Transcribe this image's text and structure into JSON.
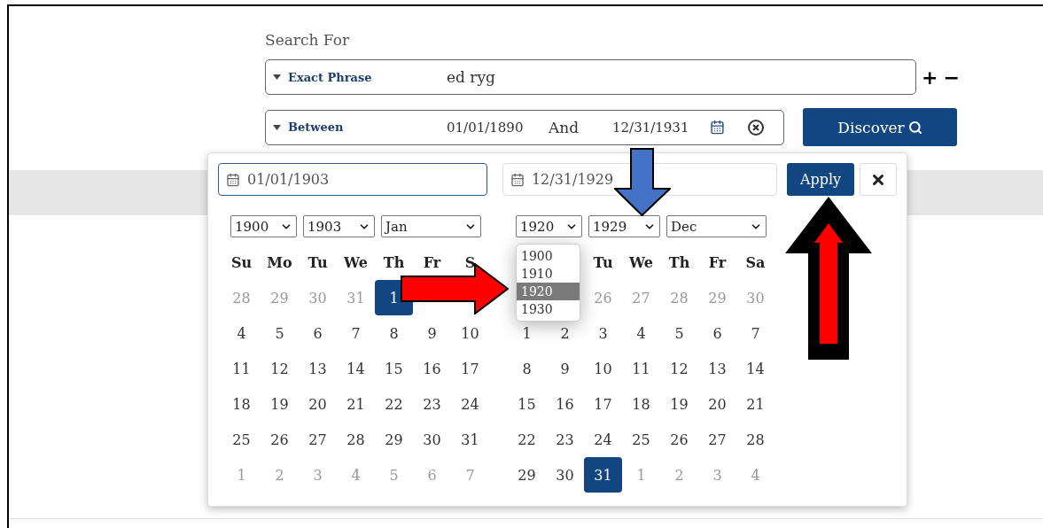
{
  "search_for_label": "Search For",
  "rows": [
    {
      "kind": "text",
      "operator": "Exact Phrase",
      "value": "ed ryg"
    },
    {
      "kind": "range",
      "operator": "Between",
      "from": "01/01/1890",
      "joiner": "And",
      "to": "12/31/1931"
    }
  ],
  "add_sign": "+",
  "remove_sign": "−",
  "discover_button": "Discover",
  "picker": {
    "from_input": "01/01/1903",
    "to_input": "12/31/1929",
    "apply_button": "Apply",
    "calendars": [
      {
        "selects": [
          "1900",
          "1903",
          "Jan"
        ],
        "weekdays": [
          {
            "label": "Su"
          },
          {
            "label": "Mo"
          },
          {
            "label": "Tu"
          },
          {
            "label": "We"
          },
          {
            "label": "Th"
          },
          {
            "label": "Fr"
          },
          {
            "label": "S"
          }
        ],
        "weeks": [
          [
            {
              "day": "28",
              "muted": true,
              "selected": false
            },
            {
              "day": "29",
              "muted": true,
              "selected": false
            },
            {
              "day": "30",
              "muted": true,
              "selected": false
            },
            {
              "day": "31",
              "muted": true,
              "selected": false
            },
            {
              "day": "1",
              "muted": false,
              "selected": true
            }
          ],
          [
            {
              "day": "4",
              "muted": false,
              "selected": false
            },
            {
              "day": "5",
              "muted": false,
              "selected": false
            },
            {
              "day": "6",
              "muted": false,
              "selected": false
            },
            {
              "day": "7",
              "muted": false,
              "selected": false
            },
            {
              "day": "8",
              "muted": false,
              "selected": false
            },
            {
              "day": "9",
              "muted": false,
              "selected": false
            },
            {
              "day": "10",
              "muted": false,
              "selected": false
            }
          ],
          [
            {
              "day": "11",
              "muted": false,
              "selected": false
            },
            {
              "day": "12",
              "muted": false,
              "selected": false
            },
            {
              "day": "13",
              "muted": false,
              "selected": false
            },
            {
              "day": "14",
              "muted": false,
              "selected": false
            },
            {
              "day": "15",
              "muted": false,
              "selected": false
            },
            {
              "day": "16",
              "muted": false,
              "selected": false
            },
            {
              "day": "17",
              "muted": false,
              "selected": false
            }
          ],
          [
            {
              "day": "18",
              "muted": false,
              "selected": false
            },
            {
              "day": "19",
              "muted": false,
              "selected": false
            },
            {
              "day": "20",
              "muted": false,
              "selected": false
            },
            {
              "day": "21",
              "muted": false,
              "selected": false
            },
            {
              "day": "22",
              "muted": false,
              "selected": false
            },
            {
              "day": "23",
              "muted": false,
              "selected": false
            },
            {
              "day": "24",
              "muted": false,
              "selected": false
            }
          ],
          [
            {
              "day": "25",
              "muted": false,
              "selected": false
            },
            {
              "day": "26",
              "muted": false,
              "selected": false
            },
            {
              "day": "27",
              "muted": false,
              "selected": false
            },
            {
              "day": "28",
              "muted": false,
              "selected": false
            },
            {
              "day": "29",
              "muted": false,
              "selected": false
            },
            {
              "day": "30",
              "muted": false,
              "selected": false
            },
            {
              "day": "31",
              "muted": false,
              "selected": false
            }
          ],
          [
            {
              "day": "1",
              "muted": true,
              "selected": false
            },
            {
              "day": "2",
              "muted": true,
              "selected": false
            },
            {
              "day": "3",
              "muted": true,
              "selected": false
            },
            {
              "day": "4",
              "muted": true,
              "selected": false
            },
            {
              "day": "5",
              "muted": true,
              "selected": false
            },
            {
              "day": "6",
              "muted": true,
              "selected": false
            },
            {
              "day": "7",
              "muted": true,
              "selected": false
            }
          ]
        ]
      },
      {
        "selects": [
          "1920",
          "1929",
          "Dec"
        ],
        "year_options": [
          {
            "label": "1900",
            "selected": false
          },
          {
            "label": "1910",
            "selected": false
          },
          {
            "label": "1920",
            "selected": true
          },
          {
            "label": "1930",
            "selected": false
          }
        ],
        "weekdays": [
          {
            "label": "Tu"
          },
          {
            "label": "We"
          },
          {
            "label": "Th"
          },
          {
            "label": "Fr"
          },
          {
            "label": "Sa"
          }
        ],
        "weeks": [
          [
            {
              "day": "26",
              "muted": true,
              "selected": false
            },
            {
              "day": "27",
              "muted": true,
              "selected": false
            },
            {
              "day": "28",
              "muted": true,
              "selected": false
            },
            {
              "day": "29",
              "muted": true,
              "selected": false
            },
            {
              "day": "30",
              "muted": true,
              "selected": false
            }
          ],
          [
            {
              "day": "1",
              "muted": false,
              "selected": false
            },
            {
              "day": "2",
              "muted": false,
              "selected": false
            },
            {
              "day": "3",
              "muted": false,
              "selected": false
            },
            {
              "day": "4",
              "muted": false,
              "selected": false
            },
            {
              "day": "5",
              "muted": false,
              "selected": false
            },
            {
              "day": "6",
              "muted": false,
              "selected": false
            },
            {
              "day": "7",
              "muted": false,
              "selected": false
            }
          ],
          [
            {
              "day": "8",
              "muted": false,
              "selected": false
            },
            {
              "day": "9",
              "muted": false,
              "selected": false
            },
            {
              "day": "10",
              "muted": false,
              "selected": false
            },
            {
              "day": "11",
              "muted": false,
              "selected": false
            },
            {
              "day": "12",
              "muted": false,
              "selected": false
            },
            {
              "day": "13",
              "muted": false,
              "selected": false
            },
            {
              "day": "14",
              "muted": false,
              "selected": false
            }
          ],
          [
            {
              "day": "15",
              "muted": false,
              "selected": false
            },
            {
              "day": "16",
              "muted": false,
              "selected": false
            },
            {
              "day": "17",
              "muted": false,
              "selected": false
            },
            {
              "day": "18",
              "muted": false,
              "selected": false
            },
            {
              "day": "19",
              "muted": false,
              "selected": false
            },
            {
              "day": "20",
              "muted": false,
              "selected": false
            },
            {
              "day": "21",
              "muted": false,
              "selected": false
            }
          ],
          [
            {
              "day": "22",
              "muted": false,
              "selected": false
            },
            {
              "day": "23",
              "muted": false,
              "selected": false
            },
            {
              "day": "24",
              "muted": false,
              "selected": false
            },
            {
              "day": "25",
              "muted": false,
              "selected": false
            },
            {
              "day": "26",
              "muted": false,
              "selected": false
            },
            {
              "day": "27",
              "muted": false,
              "selected": false
            },
            {
              "day": "28",
              "muted": false,
              "selected": false
            }
          ],
          [
            {
              "day": "29",
              "muted": false,
              "selected": false
            },
            {
              "day": "30",
              "muted": false,
              "selected": false
            },
            {
              "day": "31",
              "muted": false,
              "selected": true
            },
            {
              "day": "1",
              "muted": true,
              "selected": false
            },
            {
              "day": "2",
              "muted": true,
              "selected": false
            },
            {
              "day": "3",
              "muted": true,
              "selected": false
            },
            {
              "day": "4",
              "muted": true,
              "selected": false
            }
          ]
        ]
      }
    ]
  }
}
